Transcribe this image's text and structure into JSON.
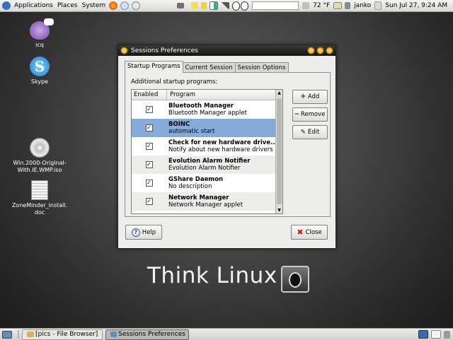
{
  "top_panel": {
    "menus": [
      "Applications",
      "Places",
      "System"
    ],
    "temperature": "72 °F",
    "user": "janko",
    "datetime": "Sun Jul 27,  9:24 AM"
  },
  "desktop": {
    "icons": [
      {
        "label": "icq",
        "icon": "icq-flower-icon"
      },
      {
        "label": "Skype",
        "icon": "skype-icon"
      },
      {
        "label": "Win.2000-Original-With.IE.WMP.iso",
        "line1": "Win.2000-Original-",
        "line2": "With.IE.WMP.iso",
        "icon": "disc-image-icon"
      },
      {
        "label": "ZoneMinder_install.doc",
        "line1": "ZoneMinder_install.",
        "line2": "doc",
        "icon": "document-icon"
      }
    ],
    "brand_text": "Think Linux"
  },
  "dialog": {
    "title": "Sessions Preferences",
    "tabs": [
      "Startup Programs",
      "Current Session",
      "Session Options"
    ],
    "active_tab": "Startup Programs",
    "section_label": "Additional startup programs:",
    "columns": [
      "Enabled",
      "Program"
    ],
    "programs": [
      {
        "name": "Bluetooth Manager",
        "description": "Bluetooth Manager applet",
        "enabled": true
      },
      {
        "name": "BOINC",
        "description": "automatic start",
        "enabled": true
      },
      {
        "name": "Check for new hardware drive...",
        "description": "Notify about new hardware drivers ...",
        "enabled": true
      },
      {
        "name": "Evolution Alarm Notifier",
        "description": "Evolution Alarm Notifier",
        "enabled": true
      },
      {
        "name": "GShare Daemon",
        "description": "No description",
        "enabled": true
      },
      {
        "name": "Network Manager",
        "description": "Network Manager applet",
        "enabled": true
      }
    ],
    "selected_program": "BOINC",
    "buttons": {
      "add": "Add",
      "remove": "Remove",
      "edit": "Edit",
      "help": "Help",
      "close": "Close"
    }
  },
  "taskbar": {
    "tasks": [
      "[pics - File Browser]",
      "Sessions Preferences"
    ],
    "active_task": "Sessions Preferences"
  },
  "colors": {
    "selection": "#86abd9",
    "titlebar": "#1e1e1e",
    "panel": "#e2e2de"
  }
}
